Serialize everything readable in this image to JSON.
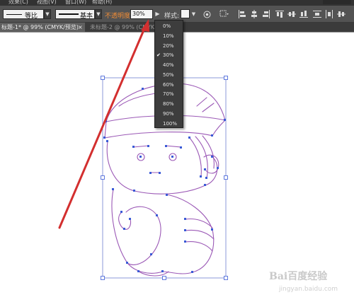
{
  "menubar": {
    "items": [
      "效果(C)",
      "视图(V)",
      "窗口(W)",
      "帮助(H)"
    ]
  },
  "controlbar": {
    "stroke_profile_1": "等比",
    "stroke_profile_2": "基本",
    "opacity_label": "不透明度",
    "opacity_value": "30%",
    "style_label": "样式:",
    "icons": [
      "globe-icon",
      "align-grid-icon",
      "align-left-icon",
      "align-center-icon",
      "align-right-icon",
      "align-top-icon",
      "align-middle-icon",
      "align-bottom-icon",
      "distribute-icon",
      "distribute-icon-2",
      "distribute-icon-3"
    ]
  },
  "tabs": {
    "active": "标题-1* @ 99% (CMYK/预览)",
    "inactive": "未标题-2 @ 99% (CMYK/..."
  },
  "opacity_menu": {
    "options": [
      "0%",
      "10%",
      "20%",
      "30%",
      "40%",
      "50%",
      "60%",
      "70%",
      "80%",
      "90%",
      "100%"
    ],
    "selected": "30%"
  },
  "colors": {
    "path_purple": "#9b59b6",
    "anchor_blue": "#3a5ad6",
    "arrow_red": "#d32f2f",
    "opacity_orange": "#f08c36"
  },
  "watermark": {
    "logo_text": "Bai百度经验",
    "url": "jingyan.baidu.com"
  }
}
